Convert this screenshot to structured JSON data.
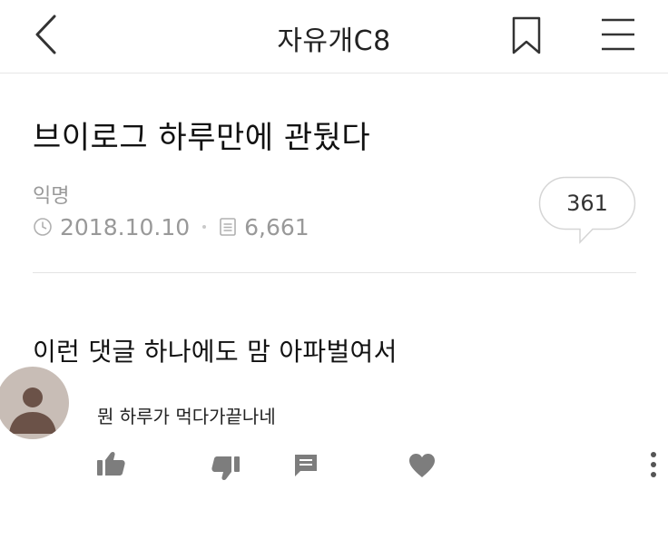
{
  "header": {
    "title": "자유개C8",
    "back_icon": "chevron-left-icon",
    "bookmark_icon": "bookmark-icon",
    "menu_icon": "hamburger-menu-icon"
  },
  "post": {
    "title": "브이로그 하루만에 관뒀다",
    "author": "익명",
    "date": "2018.10.10",
    "views": "6,661",
    "comment_count": "361",
    "body": "이런 댓글 하나에도 맘 아파벌여서"
  },
  "comment": {
    "text": "뭔 하루가 먹다가끝나네",
    "actions": [
      "thumbs-up-icon",
      "thumbs-down-icon",
      "reply-icon",
      "heart-icon",
      "more-vertical-icon"
    ]
  },
  "colors": {
    "text_primary": "#111111",
    "text_muted": "#999999",
    "icon_gray": "#7d7d7d",
    "divider": "#e3e3e3",
    "avatar_bg": "#c8bdb6"
  }
}
